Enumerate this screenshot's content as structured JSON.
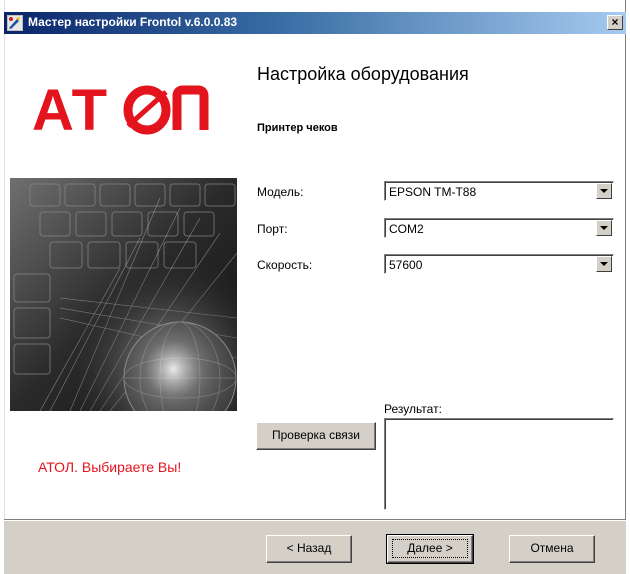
{
  "window": {
    "title": "Мастер настройки Frontol v.6.0.0.83",
    "close_symbol": "×"
  },
  "left_panel": {
    "logo_text": "АТОЛ",
    "slogan": "АТОЛ. Выбираете Вы!",
    "brand_color": "#e3141d"
  },
  "main": {
    "heading": "Настройка оборудования",
    "subheading": "Принтер чеков",
    "fields": {
      "model": {
        "label": "Модель:",
        "value": "EPSON TM-T88"
      },
      "port": {
        "label": "Порт:",
        "value": "COM2"
      },
      "speed": {
        "label": "Скорость:",
        "value": "57600"
      }
    },
    "check_button": "Проверка связи",
    "result_label": "Результат:",
    "result_value": ""
  },
  "footer": {
    "back_label": "< Назад",
    "next_label": "Далее >",
    "cancel_label": "Отмена"
  },
  "icons": {
    "app": "wizard-icon",
    "close": "close-icon",
    "dropdown": "chevron-down-icon"
  }
}
